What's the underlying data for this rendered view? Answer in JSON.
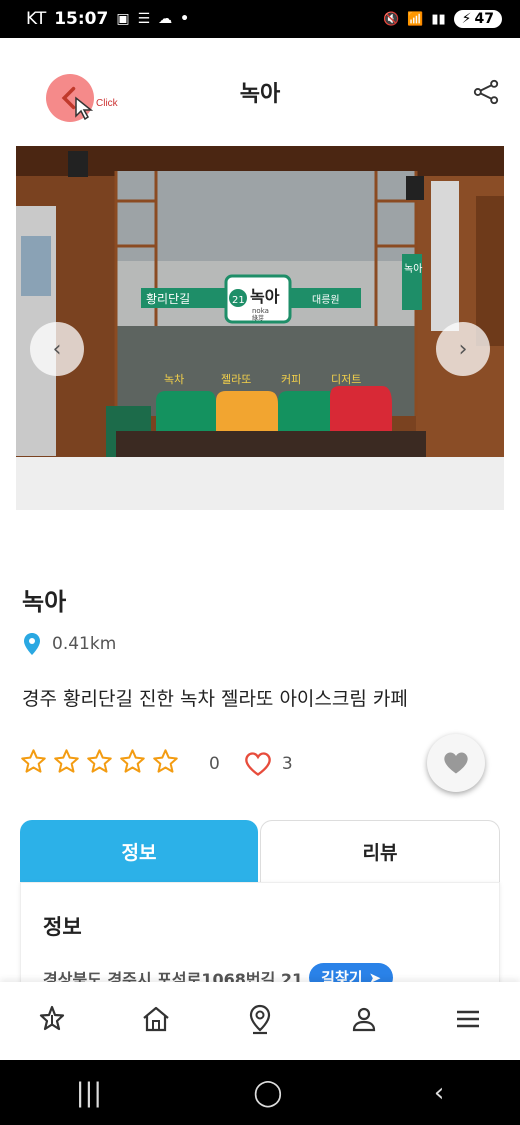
{
  "status_bar": {
    "carrier": "KT",
    "time": "15:07",
    "battery": "47"
  },
  "header": {
    "title": "녹아",
    "click_label": "Click"
  },
  "gallery": {
    "signs": {
      "left_street": "황리단길",
      "store_number": "21",
      "store_name": "녹아",
      "store_roman": "noka",
      "store_sub": "綠芽",
      "right_street": "대릉원",
      "side_sign": "녹아",
      "menu": [
        "녹차",
        "젤라또",
        "커피",
        "디저트"
      ]
    }
  },
  "place": {
    "title": "녹아",
    "distance": "0.41km",
    "description": "경주 황리단길 진한 녹차 젤라또 아이스크림 카페",
    "rating_count": "0",
    "like_count": "3"
  },
  "tabs": [
    {
      "label": "정보"
    },
    {
      "label": "리뷰"
    }
  ],
  "info": {
    "heading": "정보",
    "address": "경상북도 경주시 포석로1068번길 21",
    "route_button": "길찾기"
  },
  "colors": {
    "accent": "#2cb1e8",
    "star": "#f39c12",
    "heart": "#e74c3c",
    "route": "#2a82e8"
  }
}
